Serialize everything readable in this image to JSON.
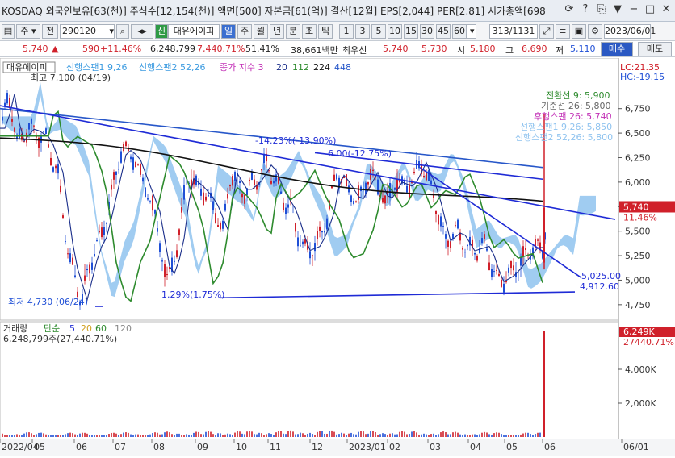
{
  "window": {
    "title": "KOSDAQ 외국인보유[63(천)] 주식수[12,154(천)] 액면[500] 자본금[61(억)] 결산[12월] EPS[2,044] PER[2.81] 시가총액[698"
  },
  "toolbar": {
    "code": "290120",
    "name": "대유에이피",
    "period_tabs": [
      "일",
      "주",
      "월",
      "년",
      "분",
      "초",
      "틱"
    ],
    "active_tab": "일",
    "numbers": [
      "1",
      "3",
      "5",
      "10",
      "15",
      "30",
      "45",
      "60"
    ],
    "count": "30",
    "range": "313/1131",
    "date": "2023/06/01",
    "buy": "매수",
    "sell": "매도",
    "prefix": "주",
    "jeon": "전",
    "sin": "신"
  },
  "quote": {
    "price": "5,740",
    "arrow": "▲",
    "change": "590",
    "change_pct": "+11.46%",
    "volume": "6,248,799",
    "volume_pct": "7,440.71%",
    "ratio": "51.41%",
    "amount": "38,661백만",
    "label_close": "최우선",
    "close": "5,740",
    "best": "5,730",
    "open_label": "시",
    "open": "5,180",
    "high_label": "고",
    "high": "6,690",
    "low_label": "저",
    "low": "5,110"
  },
  "legend": {
    "name": "대유에이피",
    "span1": "선행스팬1 9,26",
    "span2": "선행스팬2 52,26",
    "index": "종가 지수 3",
    "ma1": "20",
    "ma2": "112",
    "ma3": "224",
    "ma4": "448",
    "lc": "LC:21.35",
    "hc": "HC:-19.15",
    "max_label": "최고 7,100 (04/19)",
    "min_label": "최저 4,730 (06/24)"
  },
  "ichimoku": {
    "conv": "전환선 9: 5,900",
    "base": "기준선 26: 5,800",
    "lag": "후행스팬 26: 5,740",
    "sp1": "선행스팬1 9,26: 5,850",
    "sp2": "선행스팬2 52,26: 5,800"
  },
  "annotations": {
    "trend1": "-14.23%(-13.90%)",
    "trend2": "1.29%(1.75%)",
    "ref1": "5,025.00",
    "ref2": "4,912.60",
    "mid": "-6.00(-12.75%)"
  },
  "price_axis": [
    "6,750",
    "6,500",
    "6,250",
    "6,000",
    "5,750",
    "5,500",
    "5,250",
    "5,000",
    "4,750"
  ],
  "price_tag": {
    "price": "5,740",
    "pct": "11.46%"
  },
  "volume_legend": {
    "name": "거래량",
    "label": "단순",
    "ma1": "5",
    "ma2": "20",
    "ma3": "60",
    "ma4": "120",
    "value": "6,248,799주(27,440.71%)",
    "tag": "6,249K",
    "tag2": "27440.71%"
  },
  "volume_axis": [
    "4,000K",
    "2,000K"
  ],
  "x_axis": [
    "2022/04",
    "05",
    "06",
    "07",
    "08",
    "09",
    "10",
    "11",
    "12",
    "2023/01",
    "02",
    "03",
    "04",
    "05",
    "06",
    "06/01"
  ],
  "colors": {
    "up": "#d0202a",
    "down": "#1f4fd6",
    "cloud": "#8fc3ef",
    "ma20": "#1a2e8a",
    "ma112": "#2e8b2e",
    "ma224": "#111111",
    "trend": "#1f2bd6"
  }
}
